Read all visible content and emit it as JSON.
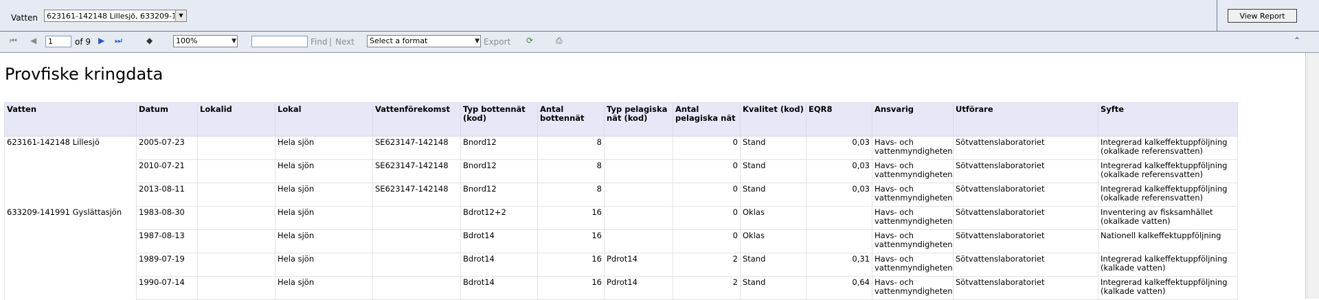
{
  "params": {
    "vatten_label": "Vatten",
    "vatten_value": "623161-142148 Lillesjö, 633209-141991 Gyslättasjön",
    "view_report_label": "View Report"
  },
  "toolbar": {
    "page_value": "1",
    "of_pages": "of 9",
    "zoom_value": "100%",
    "find_label": "Find",
    "separator": "|",
    "next_label": "Next",
    "format_value": "Select a format",
    "export_label": "Export"
  },
  "report": {
    "title": "Provfiske kringdata",
    "columns": [
      "Vatten",
      "Datum",
      "Lokalid",
      "Lokal",
      "Vattenförekomst",
      "Typ bottennät (kod)",
      "Antal bottennät",
      "Typ pelagiska nät (kod)",
      "Antal pelagiska nät",
      "Kvalitet (kod)",
      "EQR8",
      "Ansvarig",
      "Utförare",
      "Syfte"
    ],
    "rows": [
      {
        "vatten": "623161-142148 Lillesjö",
        "datum": "2005-07-23",
        "lokalid": "",
        "lokal": "Hela sjön",
        "vattenforekomst": "SE623147-142148",
        "typ_botten": "Bnord12",
        "antal_botten": "8",
        "typ_pel": "",
        "antal_pel": "0",
        "kvalitet": "Stand",
        "eqr8": "0,03",
        "ansvarig": "Havs- och vattenmyndigheten",
        "utforare": "Sötvattenslaboratoriet",
        "syfte": "Integrerad kalkeffektuppföljning (okalkade referensvatten)"
      },
      {
        "vatten": "",
        "datum": "2010-07-21",
        "lokalid": "",
        "lokal": "Hela sjön",
        "vattenforekomst": "SE623147-142148",
        "typ_botten": "Bnord12",
        "antal_botten": "8",
        "typ_pel": "",
        "antal_pel": "0",
        "kvalitet": "Stand",
        "eqr8": "0,03",
        "ansvarig": "Havs- och vattenmyndigheten",
        "utforare": "Sötvattenslaboratoriet",
        "syfte": "Integrerad kalkeffektuppföljning (okalkade referensvatten)"
      },
      {
        "vatten": "",
        "datum": "2013-08-11",
        "lokalid": "",
        "lokal": "Hela sjön",
        "vattenforekomst": "SE623147-142148",
        "typ_botten": "Bnord12",
        "antal_botten": "8",
        "typ_pel": "",
        "antal_pel": "0",
        "kvalitet": "Stand",
        "eqr8": "0,03",
        "ansvarig": "Havs- och vattenmyndigheten",
        "utforare": "Sötvattenslaboratoriet",
        "syfte": "Integrerad kalkeffektuppföljning (okalkade referensvatten)"
      },
      {
        "vatten": "633209-141991 Gyslättasjön",
        "datum": "1983-08-30",
        "lokalid": "",
        "lokal": "Hela sjön",
        "vattenforekomst": "",
        "typ_botten": "Bdrot12+2",
        "antal_botten": "16",
        "typ_pel": "",
        "antal_pel": "0",
        "kvalitet": "Oklas",
        "eqr8": "",
        "ansvarig": "Havs- och vattenmyndigheten",
        "utforare": "Sötvattenslaboratoriet",
        "syfte": "Inventering av fisksamhället (okalkade vatten)"
      },
      {
        "vatten": "",
        "datum": "1987-08-13",
        "lokalid": "",
        "lokal": "Hela sjön",
        "vattenforekomst": "",
        "typ_botten": "Bdrot14",
        "antal_botten": "16",
        "typ_pel": "",
        "antal_pel": "0",
        "kvalitet": "Oklas",
        "eqr8": "",
        "ansvarig": "Havs- och vattenmyndigheten",
        "utforare": "Sötvattenslaboratoriet",
        "syfte": "Nationell kalkeffektuppföljning"
      },
      {
        "vatten": "",
        "datum": "1989-07-19",
        "lokalid": "",
        "lokal": "Hela sjön",
        "vattenforekomst": "",
        "typ_botten": "Bdrot14",
        "antal_botten": "16",
        "typ_pel": "Pdrot14",
        "antal_pel": "2",
        "kvalitet": "Stand",
        "eqr8": "0,31",
        "ansvarig": "Havs- och vattenmyndigheten",
        "utforare": "Sötvattenslaboratoriet",
        "syfte": "Integrerad kalkeffektuppföljning (kalkade vatten)"
      },
      {
        "vatten": "",
        "datum": "1990-07-14",
        "lokalid": "",
        "lokal": "Hela sjön",
        "vattenforekomst": "",
        "typ_botten": "Bdrot14",
        "antal_botten": "16",
        "typ_pel": "Pdrot14",
        "antal_pel": "2",
        "kvalitet": "Stand",
        "eqr8": "0,64",
        "ansvarig": "Havs- och vattenmyndigheten",
        "utforare": "Sötvattenslaboratoriet",
        "syfte": "Integrerad kalkeffektuppföljning (kalkade vatten)"
      }
    ]
  }
}
